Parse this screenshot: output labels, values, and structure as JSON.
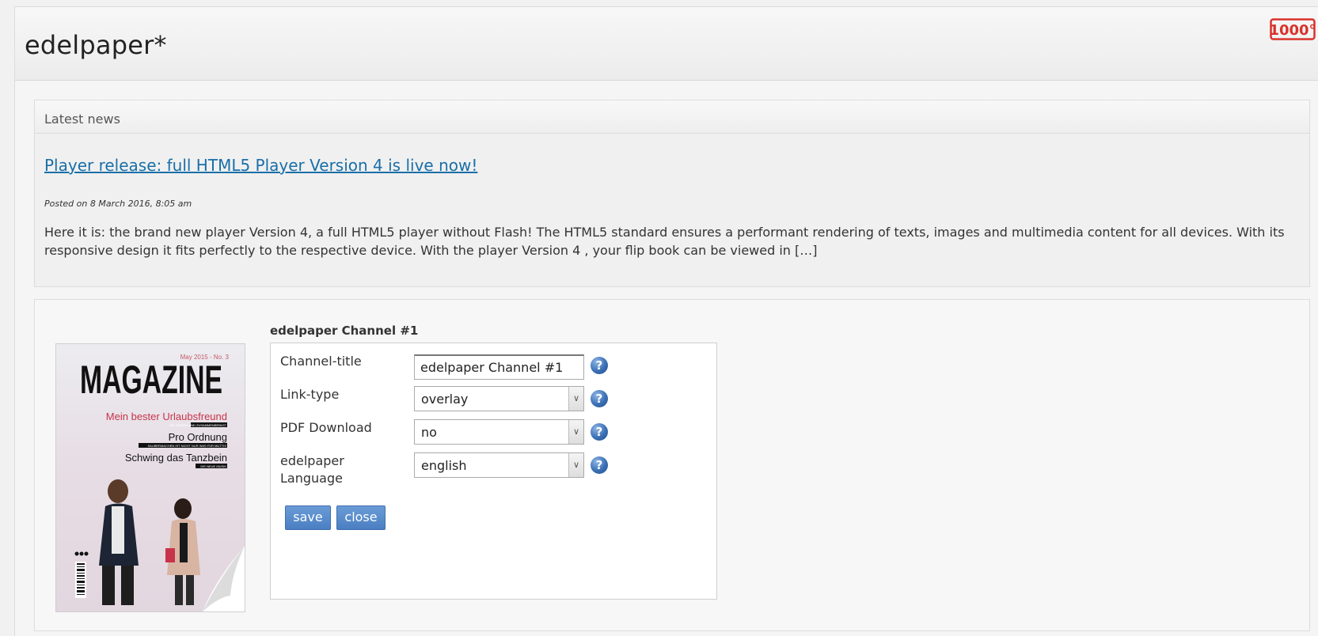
{
  "app": {
    "title": "edelpaper*",
    "logo_text": "1000°",
    "logo_color": "#d9322b"
  },
  "news": {
    "heading": "Latest news",
    "article_title": "Player release: full HTML5 Player Version 4 is live now!",
    "posted": "Posted on 8 March 2016, 8:05 am",
    "excerpt": "Here it is: the brand new player Version 4, a full HTML5 player without Flash! The HTML5 standard ensures a performant rendering of texts, images and multimedia content for all devices. With its responsive design it fits perfectly to the respective device. With the player Version 4 , your flip book can be viewed in […]"
  },
  "channel": {
    "name": "edelpaper Channel #1",
    "cover": {
      "masthead": "MAGAZINE",
      "issue": "May 2015 - No. 3",
      "lines": [
        "Mein bester Urlaubsfreund",
        "Pro Ordnung",
        "Schwing das Tanzbein"
      ],
      "sublines": [
        "WIE REISEN UND ZUSAMMENBRINGT",
        "SAUBERMACHEN IST NICHT NUR WAS FÜR MUTTIS",
        "DIE NEUE MUSIK"
      ]
    },
    "form": {
      "title_label": "Channel-title",
      "title_value": "edelpaper Channel #1",
      "link_label": "Link-type",
      "link_value": "overlay",
      "pdf_label": "PDF Download",
      "pdf_value": "no",
      "lang_label": "edelpaper Language",
      "lang_value": "english",
      "help_glyph": "?",
      "arrow_glyph": "∨"
    },
    "buttons": {
      "save": "save",
      "close": "close"
    }
  },
  "colors": {
    "link": "#1a6fa8",
    "button": "#5a8ccb",
    "help": "#3a6fb5"
  }
}
